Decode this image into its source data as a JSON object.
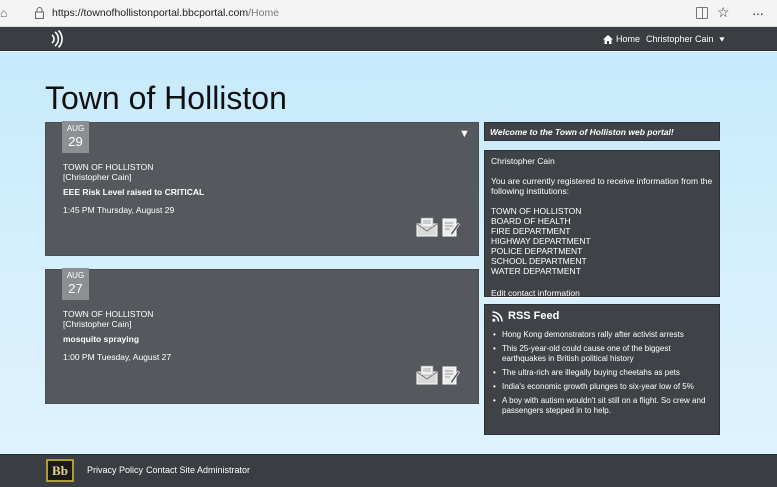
{
  "browser": {
    "url_host": "https://townofhollistonportal.bbcportal.com",
    "url_path": "/Home"
  },
  "topbar": {
    "home_label": "Home",
    "user_name": "Christopher Cain"
  },
  "page": {
    "title": "Town of Holliston"
  },
  "notifications": [
    {
      "month": "AUG",
      "day": "29",
      "institution": "TOWN OF HOLLISTON",
      "author": "[Christopher Cain]",
      "subject": "EEE Risk Level raised to CRITICAL",
      "datetime": "1:45 PM Thursday, August 29"
    },
    {
      "month": "AUG",
      "day": "27",
      "institution": "TOWN OF HOLLISTON",
      "author": "[Christopher Cain]",
      "subject": "mosquito spraying",
      "datetime": "1:00 PM Tuesday, August 27"
    }
  ],
  "welcome": {
    "text": "Welcome to the Town of Holliston web portal!"
  },
  "profile": {
    "name": "Christopher Cain",
    "note": "You are currently registered to receive information from the following institutions:",
    "institutions": [
      "TOWN OF HOLLISTON",
      "BOARD OF HEALTH",
      "FIRE DEPARTMENT",
      "HIGHWAY DEPARTMENT",
      "POLICE DEPARTMENT",
      "SCHOOL DEPARTMENT",
      "WATER DEPARTMENT"
    ],
    "edit_link": "Edit contact information"
  },
  "rss": {
    "title": "RSS Feed",
    "items": [
      "Hong Kong demonstrators rally after activist arrests",
      "This 25-year-old could cause one of the biggest earthquakes in British political history",
      "The ultra-rich are illegally buying cheetahs as pets",
      "India's economic growth plunges to six-year low of 5%",
      "A boy with autism wouldn't sit still on a flight. So crew and passengers stepped in to help."
    ]
  },
  "footer": {
    "logo_text": "Bb",
    "privacy_label": "Privacy Policy",
    "contact_label": "Contact Site Administrator"
  },
  "colors": {
    "topbar": "#3a3e42",
    "card": "#55595d",
    "panel": "#3f4347",
    "background": "#c7eafc"
  }
}
